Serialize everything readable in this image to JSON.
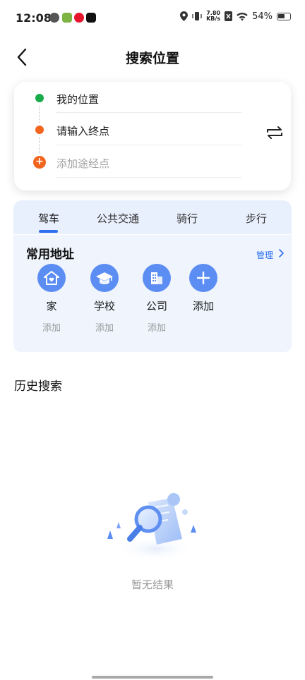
{
  "status_bar": {
    "time": "12:08",
    "net_speed_top": "7.80",
    "net_speed_bottom": "KB/s",
    "battery": "54%"
  },
  "header": {
    "title": "搜索位置"
  },
  "route": {
    "start": "我的位置",
    "end_placeholder": "请输入终点",
    "waypoint_placeholder": "添加途经点"
  },
  "tabs": [
    {
      "label": "驾车",
      "active": true
    },
    {
      "label": "公共交通",
      "active": false
    },
    {
      "label": "骑行",
      "active": false
    },
    {
      "label": "步行",
      "active": false
    }
  ],
  "common_addresses": {
    "title": "常用地址",
    "manage_label": "管理",
    "items": [
      {
        "name": "家",
        "sub": "添加",
        "icon": "home-icon"
      },
      {
        "name": "学校",
        "sub": "添加",
        "icon": "school-icon"
      },
      {
        "name": "公司",
        "sub": "添加",
        "icon": "building-icon"
      },
      {
        "name": "添加",
        "sub": "",
        "icon": "plus-icon"
      }
    ]
  },
  "history": {
    "title": "历史搜索",
    "empty_text": "暂无结果"
  },
  "colors": {
    "accent": "#2f6ff0",
    "start_dot": "#1aab4a",
    "end_dot": "#f2651f",
    "icon_bg": "#5b8df3"
  }
}
